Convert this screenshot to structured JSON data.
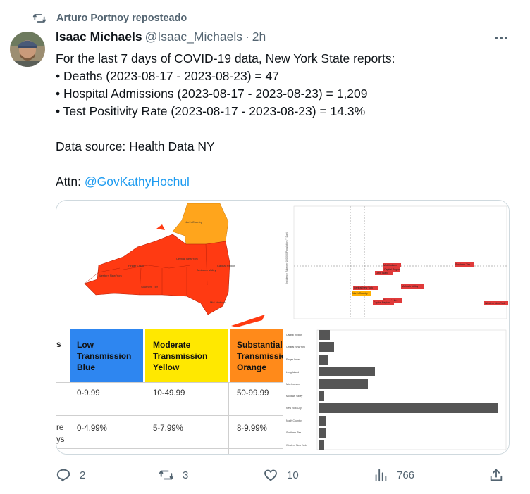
{
  "repost": {
    "label": "Arturo Portnoy reposteado"
  },
  "author": {
    "name": "Isaac Michaels",
    "handle": "@Isaac_Michaels",
    "separator": "·",
    "time": "2h"
  },
  "tweet": {
    "intro": "For the last 7 days of COVID-19 data, New York State reports:",
    "bullets": [
      "• Deaths (2023-08-17 - 2023-08-23) = 47",
      "• Hospital Admissions (2023-08-17 - 2023-08-23) = 1,209",
      "• Test Positivity Rate (2023-08-17 - 2023-08-23) = 14.3%"
    ],
    "source": "Data source: Health Data NY",
    "attn_prefix": "Attn: ",
    "attn_mention": "@GovKathyHochul"
  },
  "media": {
    "map_labels": [
      "North Country",
      "Central New York",
      "Mohawk Valley",
      "Finger Lakes",
      "Western New York",
      "Southern Tier",
      "Capital Region",
      "Mid-Hudson"
    ],
    "table": {
      "columns": [
        {
          "title_lines": [
            "Low",
            "Transmission",
            "Blue"
          ],
          "bg": "#2e86f0"
        },
        {
          "title_lines": [
            "Moderate",
            "Transmission",
            "Yellow"
          ],
          "bg": "#ffe800"
        },
        {
          "title_lines": [
            "Substantial",
            "Transmission",
            "Orange"
          ],
          "bg": "#ff8a1a"
        }
      ],
      "row1": [
        "0-9.99",
        "10-49.99",
        "50-99.99"
      ],
      "row2": [
        "0-4.99%",
        "5-7.99%",
        "8-9.99%"
      ],
      "stub_header": "s",
      "stub_row2": [
        "re",
        "ys"
      ]
    },
    "scatter": {
      "ylabel": "Incidence Rate per 100,000 Population (7 Day)",
      "points": [
        "Mid-Hudson",
        "Capital Region",
        "Long Island",
        "Southern Tier",
        "Central New York",
        "Mohawk Valley",
        "North Country",
        "Finger Lakes",
        "Capital Region",
        "Western New York"
      ]
    },
    "bar_categories": [
      "Capital Region",
      "Central New York",
      "Finger Lakes",
      "Long Island",
      "Mid-Hudson",
      "Mohawk Valley",
      "New York City",
      "North Country",
      "Southern Tier",
      "Western New York"
    ]
  },
  "actions": {
    "replies": "2",
    "reposts": "3",
    "likes": "10",
    "views": "766"
  },
  "colors": {
    "accent": "#1d9bf0",
    "secondary_text": "#536471",
    "map_red": "#ff3a12",
    "map_orange": "#ffa51c"
  },
  "icons": {
    "repost": "repost-icon",
    "more": "more-icon",
    "reply": "reply-icon",
    "like": "heart-icon",
    "views": "views-icon",
    "share": "share-icon"
  }
}
